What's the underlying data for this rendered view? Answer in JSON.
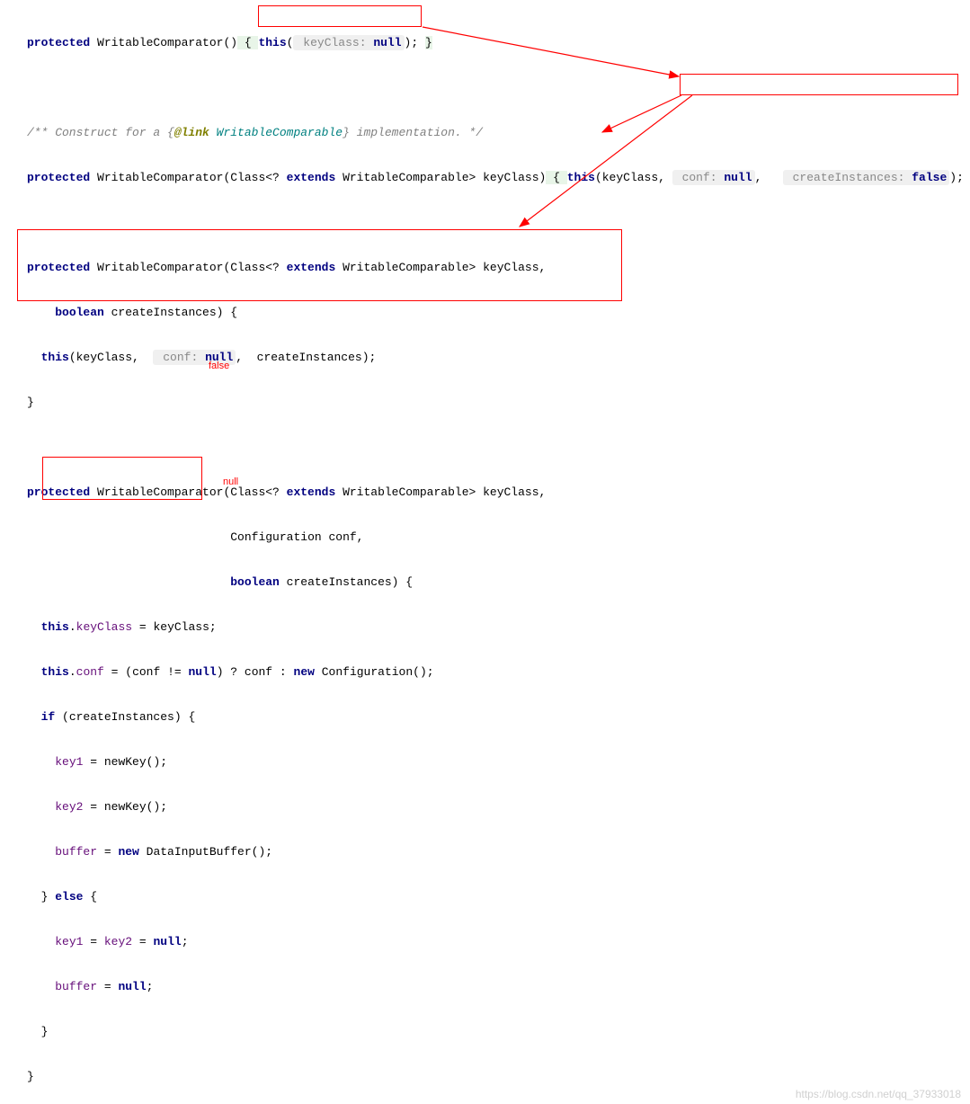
{
  "code": {
    "l1_protected": "protected",
    "l1_name": " WritableComparator()",
    "l1_brace_open": " { ",
    "l1_this": "this",
    "l1_paren_open": "(",
    "l1_hint_label": " keyClass: ",
    "l1_null": "null",
    "l1_close": "); ",
    "l1_brace_close": "}",
    "comment_open": "/** Construct for a {",
    "comment_tag": "@link",
    "comment_link": " WritableComparable",
    "comment_close": "} implementation. */",
    "l3_protected": "protected",
    "l3_sig": " WritableComparator(Class<? ",
    "l3_extends": "extends",
    "l3_sig2": " WritableComparable> keyClass)",
    "l3_brace_open": " { ",
    "l3_this": "this",
    "l3_args_open": "(keyClass, ",
    "l3_hint1_label": " conf: ",
    "l3_hint1_null": "null",
    "l3_args_mid": ",   ",
    "l3_hint2_label": " createInstances: ",
    "l3_hint2_false": "false",
    "l3_args_close": "); ",
    "l3_brace_close": "}",
    "l5_protected": "protected",
    "l5_sig": " WritableComparator(Class<? ",
    "l5_extends": "extends",
    "l5_sig2": " WritableComparable> keyClass,",
    "l6_boolean": "boolean",
    "l6_param": " createInstances) {",
    "l7_this": "this",
    "l7_open": "(keyClass,  ",
    "l7_hint_label": " conf: ",
    "l7_null": "null",
    "l7_close": ",  createInstances);",
    "l8_close": "}",
    "l10_protected": "protected",
    "l10_sig": " WritableComparator(Class<? ",
    "l10_extends": "extends",
    "l10_sig2": " WritableComparable> keyClass,",
    "l11_param": "Configuration conf,",
    "l12_boolean": "boolean",
    "l12_param": " createInstances) {",
    "l13_this": "this",
    "l13_dot": ".",
    "l13_field": "keyClass",
    "l13_rest": " = keyClass;",
    "l14_this": "this",
    "l14_dot": ".",
    "l14_field": "conf",
    "l14_rest": " = (conf != ",
    "l14_null1": "null",
    "l14_rest2": ") ? conf : ",
    "l14_new": "new",
    "l14_rest3": " Configuration();",
    "l15_if": "if",
    "l15_rest": " (createInstances) {",
    "l16_field": "key1",
    "l16_rest": " = newKey();",
    "l17_field": "key2",
    "l17_rest": " = newKey();",
    "l18_field": "buffer",
    "l18_rest": " = ",
    "l18_new": "new",
    "l18_rest2": " DataInputBuffer();",
    "l19_close": "} ",
    "l19_else": "else",
    "l19_open": " {",
    "l20_field1": "key1",
    "l20_eq1": " = ",
    "l20_field2": "key2",
    "l20_eq2": " = ",
    "l20_null": "null",
    "l20_semi": ";",
    "l21_field": "buffer",
    "l21_eq": " = ",
    "l21_null": "null",
    "l21_semi": ";",
    "l22_close": "}",
    "l23_close": "}"
  },
  "annotations": {
    "false_label": "false",
    "null_label": "null"
  },
  "watermark": "https://blog.csdn.net/qq_37933018"
}
